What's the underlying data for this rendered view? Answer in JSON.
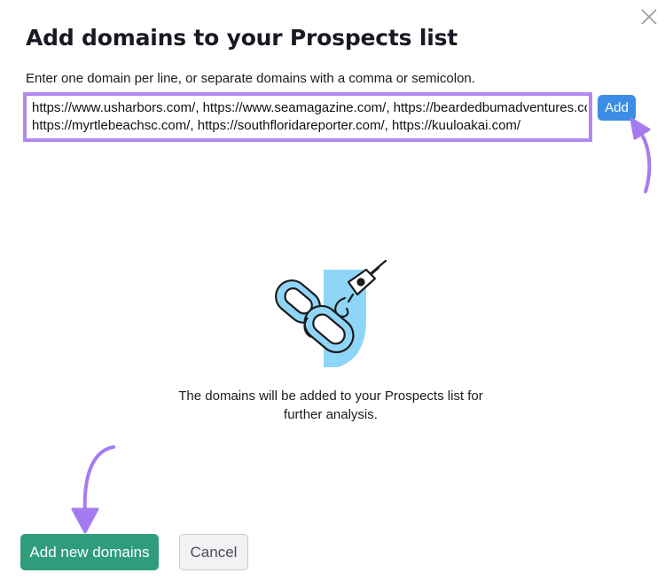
{
  "dialog": {
    "title": "Add domains to your Prospects list",
    "instructions": "Enter one domain per line, or separate domains with a comma or semicolon.",
    "domains_input": {
      "value": "https://www.usharbors.com/, https://www.seamagazine.com/, https://beardedbumadventures.com/,\nhttps://myrtlebeachsc.com/, https://southfloridareporter.com/, https://kuuloakai.com/"
    },
    "add_button_label": "Add",
    "info_text": "The domains will be added to your Prospects list for further analysis.",
    "primary_button_label": "Add new domains",
    "cancel_button_label": "Cancel"
  },
  "icons": {
    "close": "close-icon",
    "illustration": "chain-link-hook-illustration",
    "annotation_arrows": [
      "arrow-to-add-button",
      "arrow-to-add-new-domains-button"
    ]
  },
  "colors": {
    "highlight": "#b189f0",
    "add_button": "#3b8de6",
    "primary_button": "#2f9d7b",
    "illustration_blue": "#8fd5f7"
  }
}
